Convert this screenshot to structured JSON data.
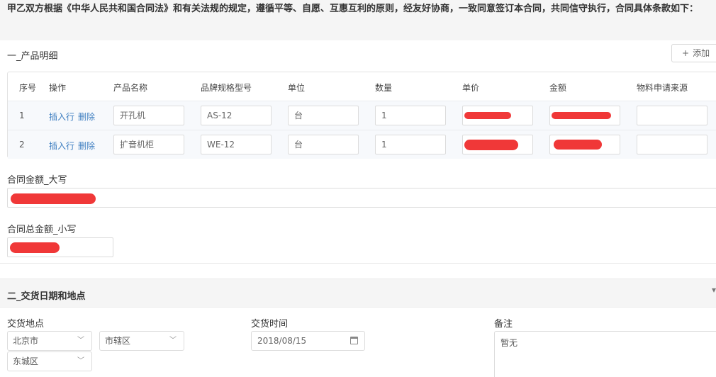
{
  "intro": "甲乙双方根据《中华人民共和国合同法》和有关法规的规定，遵循平等、自愿、互惠互利的原则，经友好协商，一致同意签订本合同，共同信守执行，合同具体条款如下：",
  "section1": {
    "title": "一_产品明细",
    "add_label": "添加",
    "headers": [
      "序号",
      "操作",
      "产品名称",
      "品牌规格型号",
      "单位",
      "数量",
      "单价",
      "金额",
      "物料申请来源"
    ],
    "op_insert": "插入行",
    "op_delete": "删除",
    "rows": [
      {
        "no": "1",
        "name": "开孔机",
        "model": "AS-12",
        "unit": "台",
        "qty": "1",
        "source": ""
      },
      {
        "no": "2",
        "name": "扩音机柜",
        "model": "WE-12",
        "unit": "台",
        "qty": "1",
        "source": ""
      }
    ]
  },
  "amount_upper_label": "合同金额_大写",
  "amount_lower_label": "合同总金额_小写",
  "section2": {
    "title": "二_交货日期和地点",
    "place_label": "交货地点",
    "city": "北京市",
    "district_type": "市辖区",
    "district": "东城区",
    "time_label": "交货时间",
    "date": "2018/08/15",
    "remark_label": "备注",
    "remark": "暂无"
  },
  "colors": {
    "link": "#3f7fc1",
    "redaction": "#f03838",
    "section_bg": "#f5f5f5"
  }
}
